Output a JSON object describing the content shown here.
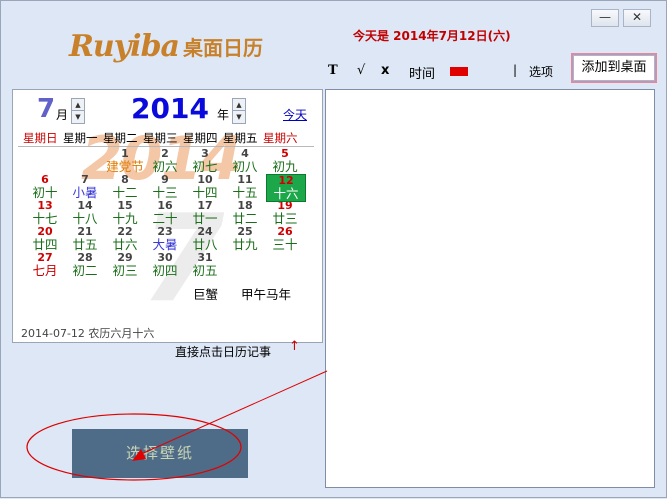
{
  "window": {
    "minimize": "—",
    "close": "✕"
  },
  "header": {
    "logo_latin": "Ruyiba",
    "logo_cn": "桌面日历",
    "today_text": "今天是 2014年7月12日(六)"
  },
  "toolbar": {
    "format_glyph": "T",
    "check_glyph": "√",
    "x_glyph": "x",
    "time_label": "时间",
    "color": "#e00000",
    "separator": "|",
    "options_label": "选项",
    "add_to_desktop_label": "添加到桌面"
  },
  "calendar": {
    "month": "7",
    "month_suffix": "月",
    "year": "2014",
    "year_suffix": "年",
    "today_link": "今天",
    "watermark_year": "2014",
    "watermark_month": "7",
    "weekdays": [
      "星期日",
      "星期一",
      "星期二",
      "星期三",
      "星期四",
      "星期五",
      "星期六"
    ],
    "weekday_colors": [
      "#cc0000",
      "#000000",
      "#000000",
      "#000000",
      "#000000",
      "#000000",
      "#cc0000"
    ],
    "days": [
      {
        "d": "1",
        "lunar": "建党节",
        "col": 2,
        "row": 0,
        "red": false,
        "lunarColor": "#e07a00"
      },
      {
        "d": "2",
        "lunar": "初六",
        "col": 3,
        "row": 0,
        "red": false,
        "lunarColor": "#1a6e1a"
      },
      {
        "d": "3",
        "lunar": "初七",
        "col": 4,
        "row": 0,
        "red": false,
        "lunarColor": "#1a6e1a"
      },
      {
        "d": "4",
        "lunar": "初八",
        "col": 5,
        "row": 0,
        "red": false,
        "lunarColor": "#1a6e1a"
      },
      {
        "d": "5",
        "lunar": "初九",
        "col": 6,
        "row": 0,
        "red": true,
        "lunarColor": "#1a6e1a"
      },
      {
        "d": "6",
        "lunar": "初十",
        "col": 0,
        "row": 1,
        "red": true,
        "lunarColor": "#1a6e1a"
      },
      {
        "d": "7",
        "lunar": "小暑",
        "col": 1,
        "row": 1,
        "red": false,
        "lunarColor": "#3b3bd6"
      },
      {
        "d": "8",
        "lunar": "十二",
        "col": 2,
        "row": 1,
        "red": false,
        "lunarColor": "#1a6e1a"
      },
      {
        "d": "9",
        "lunar": "十三",
        "col": 3,
        "row": 1,
        "red": false,
        "lunarColor": "#1a6e1a"
      },
      {
        "d": "10",
        "lunar": "十四",
        "col": 4,
        "row": 1,
        "red": false,
        "lunarColor": "#1a6e1a"
      },
      {
        "d": "11",
        "lunar": "十五",
        "col": 5,
        "row": 1,
        "red": false,
        "lunarColor": "#1a6e1a"
      },
      {
        "d": "13",
        "lunar": "十七",
        "col": 0,
        "row": 2,
        "red": true,
        "lunarColor": "#1a6e1a"
      },
      {
        "d": "14",
        "lunar": "十八",
        "col": 1,
        "row": 2,
        "red": false,
        "lunarColor": "#1a6e1a"
      },
      {
        "d": "15",
        "lunar": "十九",
        "col": 2,
        "row": 2,
        "red": false,
        "lunarColor": "#1a6e1a"
      },
      {
        "d": "16",
        "lunar": "二十",
        "col": 3,
        "row": 2,
        "red": false,
        "lunarColor": "#1a6e1a"
      },
      {
        "d": "17",
        "lunar": "廿一",
        "col": 4,
        "row": 2,
        "red": false,
        "lunarColor": "#1a6e1a"
      },
      {
        "d": "18",
        "lunar": "廿二",
        "col": 5,
        "row": 2,
        "red": false,
        "lunarColor": "#1a6e1a"
      },
      {
        "d": "19",
        "lunar": "廿三",
        "col": 6,
        "row": 2,
        "red": true,
        "lunarColor": "#1a6e1a"
      },
      {
        "d": "20",
        "lunar": "廿四",
        "col": 0,
        "row": 3,
        "red": true,
        "lunarColor": "#1a6e1a"
      },
      {
        "d": "21",
        "lunar": "廿五",
        "col": 1,
        "row": 3,
        "red": false,
        "lunarColor": "#1a6e1a"
      },
      {
        "d": "22",
        "lunar": "廿六",
        "col": 2,
        "row": 3,
        "red": false,
        "lunarColor": "#1a6e1a"
      },
      {
        "d": "23",
        "lunar": "大暑",
        "col": 3,
        "row": 3,
        "red": false,
        "lunarColor": "#3b3bd6"
      },
      {
        "d": "24",
        "lunar": "廿八",
        "col": 4,
        "row": 3,
        "red": false,
        "lunarColor": "#1a6e1a"
      },
      {
        "d": "25",
        "lunar": "廿九",
        "col": 5,
        "row": 3,
        "red": false,
        "lunarColor": "#1a6e1a"
      },
      {
        "d": "26",
        "lunar": "三十",
        "col": 6,
        "row": 3,
        "red": true,
        "lunarColor": "#1a6e1a"
      },
      {
        "d": "27",
        "lunar": "七月",
        "col": 0,
        "row": 4,
        "red": true,
        "lunarColor": "#cc0000"
      },
      {
        "d": "28",
        "lunar": "初二",
        "col": 1,
        "row": 4,
        "red": false,
        "lunarColor": "#1a6e1a"
      },
      {
        "d": "29",
        "lunar": "初三",
        "col": 2,
        "row": 4,
        "red": false,
        "lunarColor": "#1a6e1a"
      },
      {
        "d": "30",
        "lunar": "初四",
        "col": 3,
        "row": 4,
        "red": false,
        "lunarColor": "#1a6e1a"
      },
      {
        "d": "31",
        "lunar": "初五",
        "col": 4,
        "row": 4,
        "red": false,
        "lunarColor": "#1a6e1a"
      }
    ],
    "selected": {
      "d": "12",
      "lunar": "十六"
    },
    "zodiac": "巨蟹",
    "ganzhi": "甲午马年",
    "footer": "2014-07-12 农历六月十六"
  },
  "hint": "直接点击日历记事",
  "hint_arrow": "↑",
  "wallpaper_button": "选择壁纸",
  "notes": {
    "value": ""
  }
}
